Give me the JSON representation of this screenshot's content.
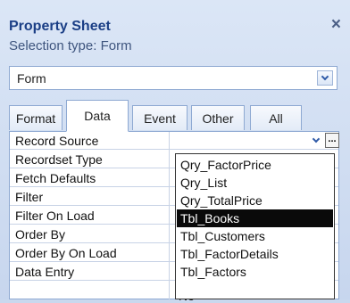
{
  "header": {
    "title": "Property Sheet",
    "close_glyph": "×"
  },
  "selection": {
    "label": "Selection type:",
    "value": "Form"
  },
  "object_combo": {
    "value": "Form"
  },
  "tabs": [
    {
      "label": "Format",
      "active": false
    },
    {
      "label": "Data",
      "active": true
    },
    {
      "label": "Event",
      "active": false
    },
    {
      "label": "Other",
      "active": false
    },
    {
      "label": "All",
      "active": false
    }
  ],
  "properties": [
    "Record Source",
    "Recordset Type",
    "Fetch Defaults",
    "Filter",
    "Filter On Load",
    "Order By",
    "Order By On Load",
    "Data Entry"
  ],
  "record_source": {
    "builder_label": "..."
  },
  "dropdown": {
    "items": [
      "Qry_FactorPrice",
      "Qry_List",
      "Qry_TotalPrice",
      "Tbl_Books",
      "Tbl_Customers",
      "Tbl_FactorDetails",
      "Tbl_Factors"
    ],
    "selected": "Tbl_Books"
  },
  "partial_value": "No",
  "colors": {
    "accent": "#1b3f86",
    "selection_bg": "#0a0a0a"
  }
}
